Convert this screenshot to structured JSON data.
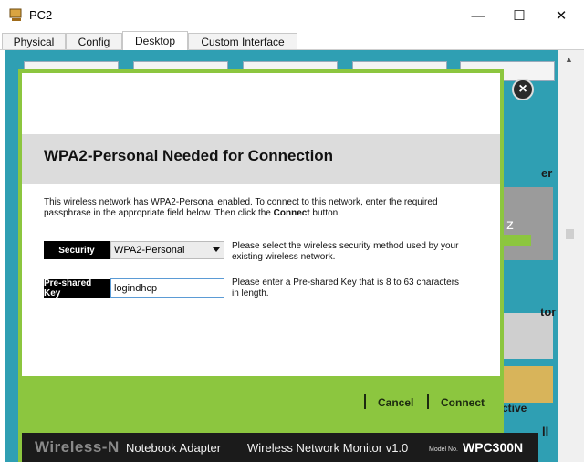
{
  "window": {
    "title": "PC2",
    "minimize_glyph": "—",
    "maximize_glyph": "☐",
    "close_glyph": "✕"
  },
  "tabs": [
    {
      "label": "Physical"
    },
    {
      "label": "Config"
    },
    {
      "label": "Desktop"
    },
    {
      "label": "Custom Interface"
    }
  ],
  "background_fragments": {
    "er": "er",
    "z": "z",
    "tor": "tor",
    "ctive": "ctive",
    "ll": "ll"
  },
  "dialog": {
    "heading": "WPA2-Personal Needed for Connection",
    "description_intro": "This wireless network has WPA2-Personal enabled. To connect to this network, enter the required passphrase in the appropriate field below. Then click the ",
    "description_bold": "Connect",
    "description_outro": " button.",
    "security": {
      "label": "Security",
      "selected": "WPA2-Personal",
      "hint_line1": "Please select the wireless security method used by your",
      "hint_line2": "existing wireless network."
    },
    "psk": {
      "label": "Pre-shared Key",
      "value": "logindhcp",
      "hint_line1": "Please enter a Pre-shared Key that is 8 to 63 characters",
      "hint_line2": "in length."
    },
    "cancel_label": "Cancel",
    "connect_label": "Connect",
    "close_glyph": "×"
  },
  "footer": {
    "brand": "Wireless-N",
    "product": "Notebook Adapter",
    "monitor": "Wireless Network Monitor  v1.0",
    "model_no_label": "Model No.",
    "model": "WPC300N"
  },
  "colors": {
    "accent_green": "#8cc63f",
    "desktop_teal": "#2f9fb3"
  }
}
